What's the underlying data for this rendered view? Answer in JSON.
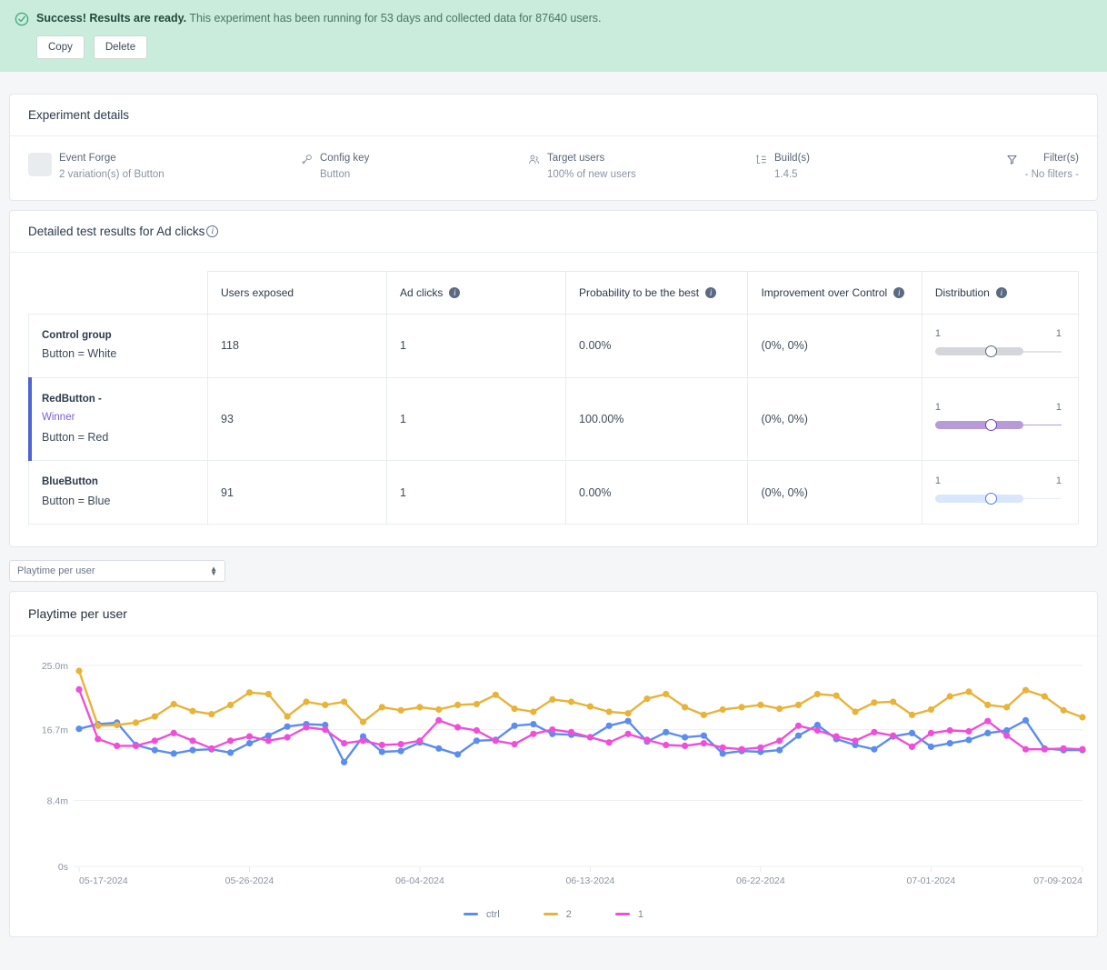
{
  "banner": {
    "status_icon": "check-circle-icon",
    "headline": "Success! Results are ready.",
    "detail": "This experiment has been running for 53 days and collected data for 87640 users.",
    "copy_label": "Copy",
    "delete_label": "Delete",
    "bg_color": "#c9ecdc"
  },
  "experiment_details": {
    "title": "Experiment details",
    "items": [
      {
        "icon": "thumbnail-placeholder",
        "label": "Event Forge",
        "value": "2 variation(s) of Button"
      },
      {
        "icon": "key-icon",
        "label": "Config key",
        "value": "Button"
      },
      {
        "icon": "users-icon",
        "label": "Target users",
        "value": "100% of new users"
      },
      {
        "icon": "build-icon",
        "label": "Build(s)",
        "value": "1.4.5"
      },
      {
        "icon": "filter-icon",
        "label": "Filter(s)",
        "value": "- No filters -"
      }
    ]
  },
  "results": {
    "title": "Detailed test results for Ad clicks",
    "title_info_icon": "info-outline-icon",
    "columns": [
      {
        "label": "",
        "info": false
      },
      {
        "label": "Users exposed",
        "info": false
      },
      {
        "label": "Ad clicks",
        "info": true
      },
      {
        "label": "Probability to be the best",
        "info": true
      },
      {
        "label": "Improvement over Control",
        "info": true
      },
      {
        "label": "Distribution",
        "info": true
      }
    ],
    "rows": [
      {
        "name": "Control group",
        "winner_label": "",
        "description": "Button = White",
        "users_exposed": "118",
        "ad_clicks": "1",
        "probability": "0.00%",
        "improvement": "(0%, 0%)",
        "is_winner": false,
        "dist": {
          "low": "1",
          "high": "1",
          "bar_color": "#d4d6d9",
          "tail_color": "#e2e4e7",
          "knob_color": "#5b6a82",
          "bar_pct": 68,
          "knob_pct": 43
        }
      },
      {
        "name": "RedButton -",
        "winner_label": "Winner",
        "description": "Button = Red",
        "users_exposed": "93",
        "ad_clicks": "1",
        "probability": "100.00%",
        "improvement": "(0%, 0%)",
        "is_winner": true,
        "dist": {
          "low": "1",
          "high": "1",
          "bar_color": "#b79ad8",
          "tail_color": "#b79ad8",
          "knob_color": "#7a3fb8",
          "bar_pct": 68,
          "knob_pct": 43
        }
      },
      {
        "name": "BlueButton",
        "winner_label": "",
        "description": "Button = Blue",
        "users_exposed": "91",
        "ad_clicks": "1",
        "probability": "0.00%",
        "improvement": "(0%, 0%)",
        "is_winner": false,
        "dist": {
          "low": "1",
          "high": "1",
          "bar_color": "#d9e6fb",
          "tail_color": "#e6eefd",
          "knob_color": "#4f7fe0",
          "bar_pct": 68,
          "knob_pct": 43
        }
      }
    ]
  },
  "metric_selector": {
    "selected": "Playtime per user",
    "options": [
      "Playtime per user"
    ],
    "icon": "chevron-updown-icon"
  },
  "chart_card": {
    "title": "Playtime per user"
  },
  "chart_data": {
    "type": "line",
    "title": "Playtime per user",
    "xlabel": "",
    "ylabel": "",
    "grid": true,
    "legend_position": "bottom",
    "ytick_labels": [
      "25.0m",
      "16.7m",
      "8.4m",
      "0s"
    ],
    "ytick_values": [
      1500,
      1002,
      504,
      0
    ],
    "ylim": [
      0,
      1500
    ],
    "ytick_pixel_fractions": [
      0.0,
      0.318,
      0.669,
      0.996
    ],
    "xtick_labels": [
      "05-17-2024",
      "05-26-2024",
      "06-04-2024",
      "06-13-2024",
      "06-22-2024",
      "07-01-2024",
      "07-09-2024"
    ],
    "xtick_indices": [
      0,
      9,
      18,
      27,
      36,
      45,
      53
    ],
    "series": [
      {
        "name": "ctrl",
        "color": "#5b8def",
        "values": [
          16.8,
          17.4,
          17.6,
          14.9,
          14.3,
          13.9,
          14.3,
          14.4,
          14.0,
          15.1,
          16.0,
          17.1,
          17.4,
          17.3,
          12.9,
          15.9,
          14.1,
          14.2,
          15.2,
          14.5,
          13.8,
          15.4,
          15.5,
          17.2,
          17.4,
          16.2,
          16.1,
          15.8,
          17.2,
          17.8,
          15.3,
          16.4,
          15.8,
          16.0,
          13.9,
          14.2,
          14.1,
          14.3,
          16.0,
          17.3,
          15.6,
          14.9,
          14.4,
          15.9,
          16.3,
          14.7,
          15.1,
          15.5,
          16.3,
          16.6,
          17.9,
          14.5,
          14.3,
          14.3
        ]
      },
      {
        "name": "2",
        "color": "#e8b339",
        "values": [
          24.3,
          17.2,
          17.3,
          17.6,
          18.4,
          20.0,
          19.1,
          18.7,
          19.9,
          21.5,
          21.3,
          18.4,
          20.3,
          19.9,
          20.3,
          17.7,
          19.6,
          19.2,
          19.6,
          19.3,
          19.9,
          20.0,
          21.2,
          19.4,
          19.0,
          20.6,
          20.3,
          19.7,
          19.0,
          18.8,
          20.7,
          21.3,
          19.6,
          18.6,
          19.3,
          19.6,
          19.9,
          19.4,
          19.9,
          21.3,
          21.1,
          19.0,
          20.2,
          20.3,
          18.6,
          19.3,
          21.0,
          21.6,
          19.9,
          19.6,
          21.8,
          21.0,
          19.2,
          18.3
        ]
      },
      {
        "name": "1",
        "color": "#ef4fd8",
        "values": [
          21.9,
          15.6,
          14.8,
          14.8,
          15.4,
          16.3,
          15.4,
          14.5,
          15.4,
          15.9,
          15.4,
          15.8,
          17.0,
          16.7,
          15.1,
          15.4,
          14.9,
          15.0,
          15.4,
          17.9,
          17.0,
          16.6,
          15.4,
          15.0,
          16.2,
          16.7,
          16.4,
          15.8,
          15.2,
          16.2,
          15.5,
          14.9,
          14.8,
          15.1,
          14.6,
          14.4,
          14.6,
          15.4,
          17.2,
          16.6,
          15.9,
          15.4,
          16.4,
          16.0,
          14.7,
          16.3,
          16.6,
          16.5,
          17.8,
          16.0,
          14.4,
          14.4,
          14.5,
          14.4
        ]
      }
    ],
    "legend": [
      {
        "label": "ctrl",
        "color": "#5b8def"
      },
      {
        "label": "2",
        "color": "#e8b339"
      },
      {
        "label": "1",
        "color": "#ef4fd8"
      }
    ]
  }
}
